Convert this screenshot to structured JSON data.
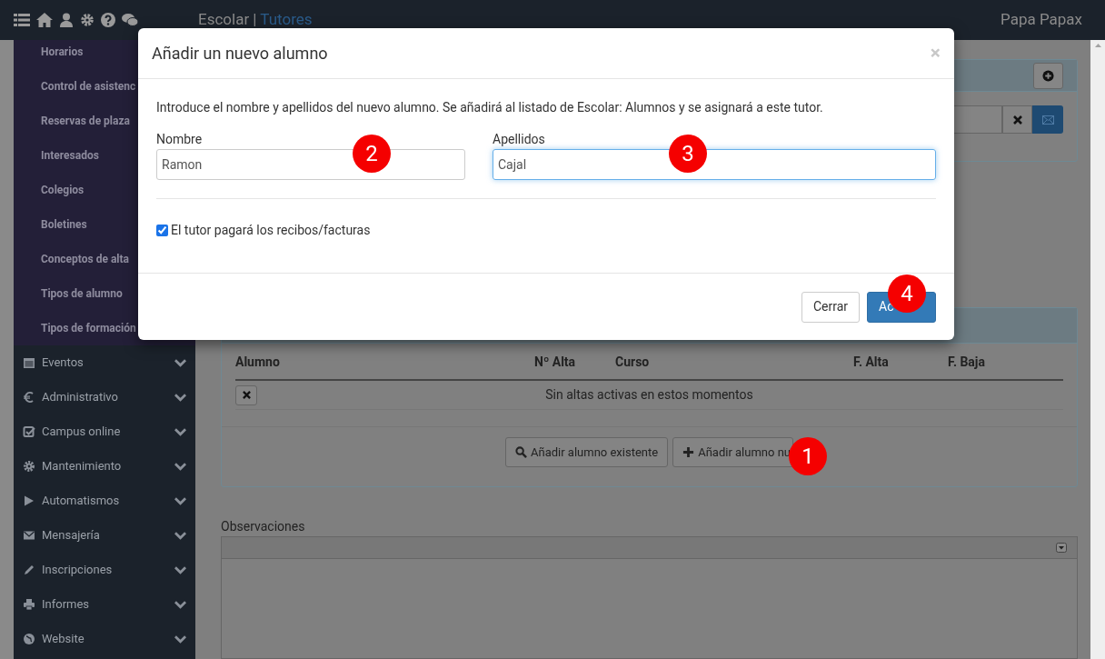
{
  "navbar": {
    "app": "Escolar",
    "separator": "|",
    "section": "Tutores",
    "user": "Papa Papax"
  },
  "sidebar": {
    "submenu": [
      "Horarios",
      "Control de asistenc",
      "Reservas de plaza",
      "Interesados",
      "Colegios",
      "Boletines",
      "Conceptos de alta",
      "Tipos de alumno",
      "Tipos de formación"
    ],
    "items": [
      {
        "label": "Eventos",
        "expanded": false
      },
      {
        "label": "Administrativo",
        "expanded": false
      },
      {
        "label": "Campus online",
        "expanded": false
      },
      {
        "label": "Mantenimiento",
        "expanded": false
      },
      {
        "label": "Automatismos",
        "expanded": false
      },
      {
        "label": "Mensajería",
        "expanded": false
      },
      {
        "label": "Inscripciones",
        "expanded": false
      },
      {
        "label": "Informes",
        "expanded": false
      },
      {
        "label": "Website",
        "expanded": false
      }
    ]
  },
  "enrollments": {
    "columns": [
      "Alumno",
      "Nº Alta",
      "Curso",
      "F. Alta",
      "F. Baja"
    ],
    "empty_message": "Sin altas activas en estos momentos",
    "buttons": [
      "Añadir alumno existente",
      "Añadir alumno nu"
    ]
  },
  "observations": {
    "label": "Observaciones"
  },
  "modal": {
    "title": "Añadir un nuevo alumno",
    "close": "×",
    "intro": "Introduce el nombre y apellidos del nuevo alumno. Se añadirá al listado de Escolar: Alumnos y se asignará a este tutor.",
    "fields": [
      {
        "label": "Nombre",
        "value": "Ramon",
        "focused": false
      },
      {
        "label": "Apellidos",
        "value": "Cajal",
        "focused": true
      }
    ],
    "checkbox": {
      "label": "El tutor pagará los recibos/facturas",
      "checked": true
    },
    "buttons": [
      {
        "label": "Cerrar",
        "kind": "default"
      },
      {
        "label": "Ac",
        "kind": "primary"
      }
    ]
  },
  "annotations": [
    "1",
    "2",
    "3",
    "4"
  ]
}
